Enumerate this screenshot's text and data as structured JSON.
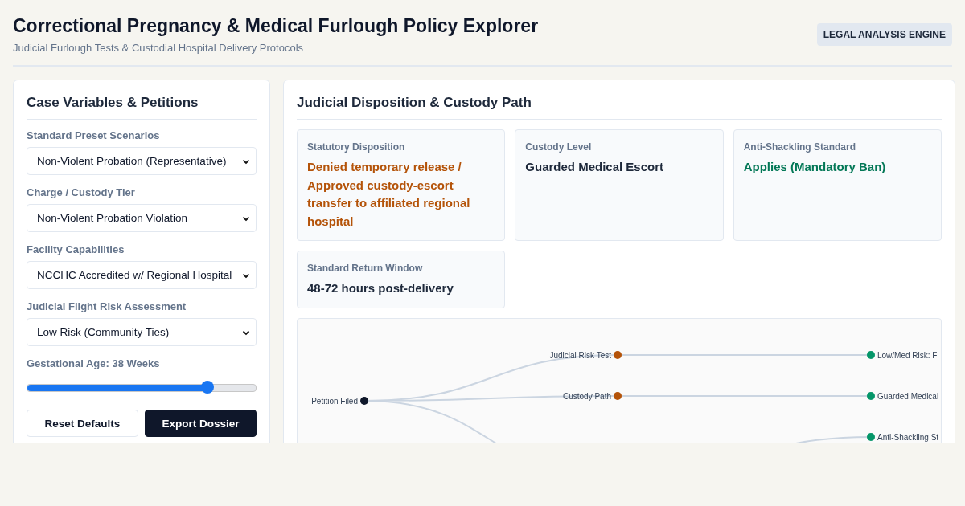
{
  "header": {
    "title": "Correctional Pregnancy & Medical Furlough Policy Explorer",
    "subtitle": "Judicial Furlough Tests & Custodial Hospital Delivery Protocols",
    "badge": "LEGAL ANALYSIS ENGINE"
  },
  "controls": {
    "title": "Case Variables & Petitions",
    "fields": [
      {
        "label": "Standard Preset Scenarios",
        "value": "Non-Violent Probation (Representative)"
      },
      {
        "label": "Charge / Custody Tier",
        "value": "Non-Violent Probation Violation"
      },
      {
        "label": "Facility Capabilities",
        "value": "NCCHC Accredited w/ Regional Hospital"
      },
      {
        "label": "Judicial Flight Risk Assessment",
        "value": "Low Risk (Community Ties)"
      }
    ],
    "slider": {
      "label": "Gestational Age: 38 Weeks",
      "level": 0.79
    },
    "buttons": [
      {
        "label": "Reset Defaults",
        "kind": "secondary"
      },
      {
        "label": "Export Dossier",
        "kind": "primary"
      }
    ]
  },
  "results": {
    "title": "Judicial Disposition & Custody Path",
    "cards": [
      {
        "label": "Statutory Disposition",
        "value": "Denied temporary release / Approved custody-escort transfer to affiliated regional hospital",
        "color": "#b45309"
      },
      {
        "label": "Custody Level",
        "value": "Guarded Medical Escort",
        "color": "#1e293b"
      },
      {
        "label": "Anti-Shackling Standard",
        "value": "Applies (Mandatory Ban)",
        "color": "#047857"
      },
      {
        "label": "Standard Return Window",
        "value": "48-72 hours post-delivery",
        "color": "#1e293b"
      }
    ],
    "diagram": {
      "root": {
        "label": "Petition Filed",
        "color": "#0f172a"
      },
      "branches": [
        {
          "label": "Judicial Risk Test",
          "color": "#b45309",
          "outcome": {
            "label": "Low/Med Risk: F",
            "color": "#059669"
          }
        },
        {
          "label": "Custody Path",
          "color": "#b45309",
          "outcome": {
            "label": "Guarded Medical",
            "color": "#059669"
          }
        },
        {
          "outcome": {
            "label": "Anti-Shackling St",
            "color": "#059669"
          }
        }
      ]
    }
  }
}
